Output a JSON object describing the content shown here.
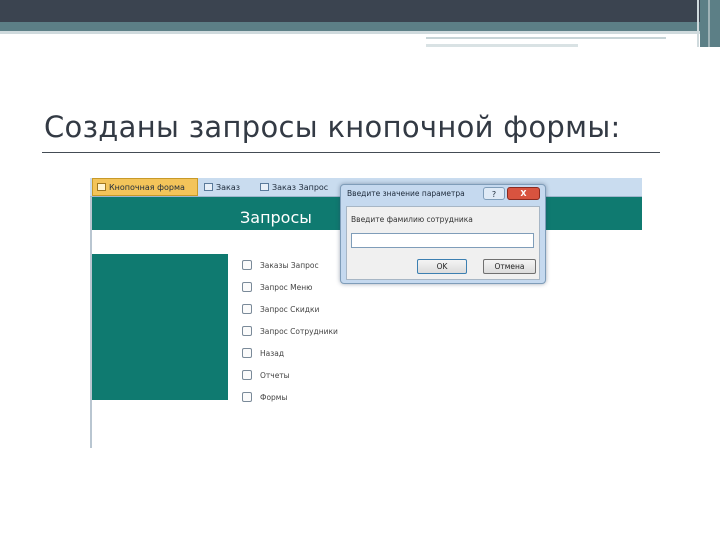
{
  "slide": {
    "title": "Созданы запросы кнопочной формы:"
  },
  "tabs": [
    {
      "label": "Кнопочная форма",
      "active": true
    },
    {
      "label": "Заказ",
      "active": false
    },
    {
      "label": "Заказ Запрос",
      "active": false
    }
  ],
  "form": {
    "title": "Запросы",
    "accent_color": "#0f7a70",
    "items": [
      {
        "label": "Заказы Запрос"
      },
      {
        "label": "Запрос Меню"
      },
      {
        "label": "Запрос Скидки"
      },
      {
        "label": "Запрос Сотрудники"
      },
      {
        "label": "Назад"
      },
      {
        "label": "Отчеты"
      },
      {
        "label": "Формы"
      }
    ]
  },
  "dialog": {
    "title": "Введите значение параметра",
    "help_label": "?",
    "close_label": "X",
    "prompt": "Введите фамилию сотрудника",
    "input_value": "",
    "ok_label": "OK",
    "cancel_label": "Отмена"
  }
}
